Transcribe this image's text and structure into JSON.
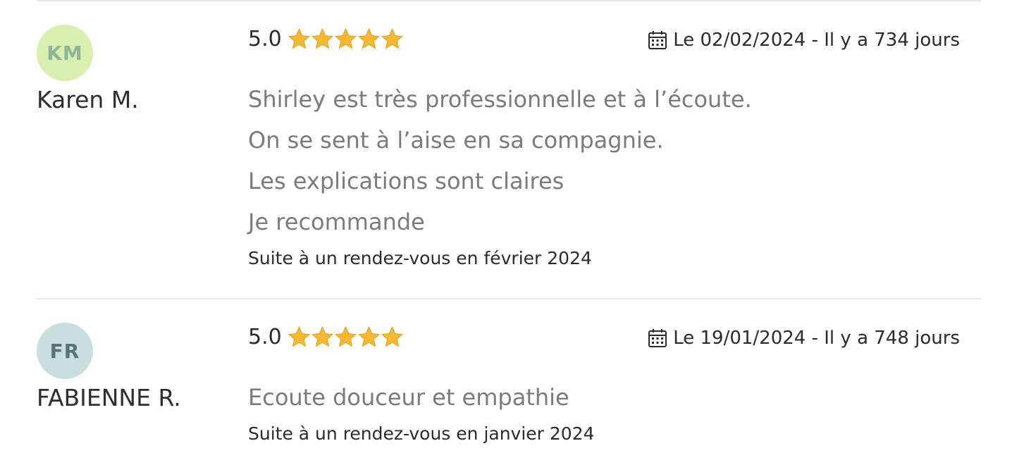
{
  "reviews": [
    {
      "initials": "KM",
      "avatar_bg": "#d8efb0",
      "avatar_fg": "#8ab79a",
      "author": "Karen M.",
      "rating": "5.0",
      "stars": 5,
      "date": "Le 02/02/2024 - Il y a 734 jours",
      "body": [
        "Shirley est très professionnelle et à l’écoute.",
        "On se sent à l’aise en sa compagnie.",
        "Les explications sont claires",
        "Je recommande"
      ],
      "context": "Suite à un rendez-vous en février 2024"
    },
    {
      "initials": "FR",
      "avatar_bg": "#c9dfdf",
      "avatar_fg": "#5a7272",
      "author": "FABIENNE R.",
      "rating": "5.0",
      "stars": 5,
      "date": "Le 19/01/2024 - Il y a 748 jours",
      "body": [
        "Ecoute douceur et empathie"
      ],
      "context": "Suite à un rendez-vous en janvier 2024"
    }
  ],
  "colors": {
    "star": "#f5b82e",
    "divider": "#e6e6e6",
    "body_text": "#7b7b7b"
  },
  "icons": {
    "star": "star-icon",
    "calendar": "calendar-icon"
  }
}
